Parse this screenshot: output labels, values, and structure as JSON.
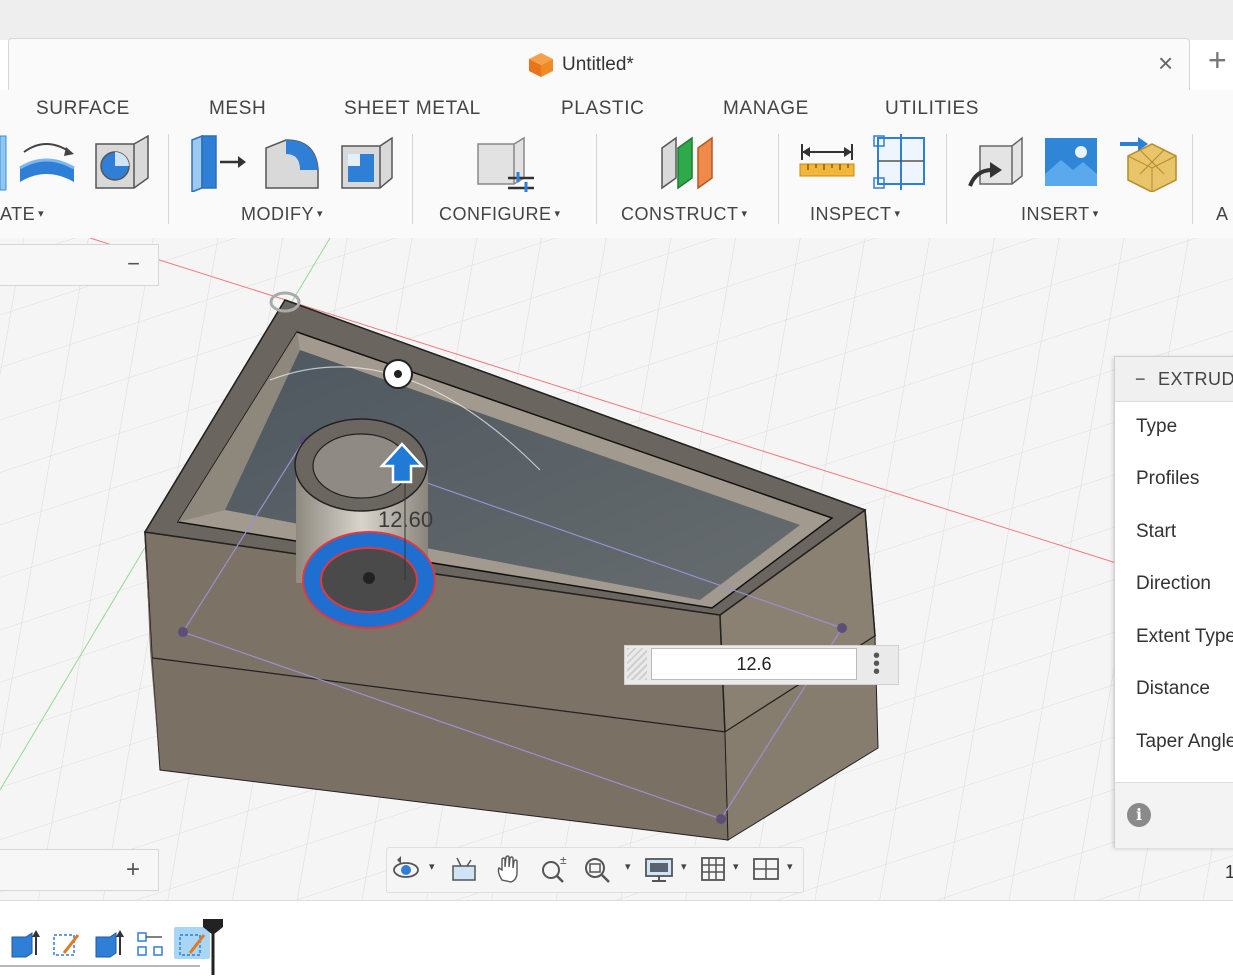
{
  "document": {
    "title": "Untitled*"
  },
  "ribbon": {
    "tabs": [
      "SURFACE",
      "MESH",
      "SHEET METAL",
      "PLASTIC",
      "MANAGE",
      "UTILITIES"
    ],
    "groups": {
      "create": "ATE",
      "modify": "MODIFY",
      "configure": "CONFIGURE",
      "construct": "CONSTRUCT",
      "inspect": "INSPECT",
      "insert": "INSERT",
      "next": "A"
    },
    "caret": "▾"
  },
  "panels": {
    "browser_minimize": "−",
    "comments_add": "+"
  },
  "viewport": {
    "dimension_label": "12.60",
    "dimension_input_value": "12.6"
  },
  "extrude": {
    "header_title": "EXTRUDE",
    "collapse": "−",
    "fields": [
      "Type",
      "Profiles",
      "Start",
      "Direction",
      "Extent Type",
      "Distance",
      "Taper Angle"
    ],
    "info": "i"
  },
  "status": {
    "right_char": "1"
  },
  "colors": {
    "accent_blue": "#1f6fd1",
    "profile_red": "#e0393e",
    "selection_blue": "#a9d6f5",
    "cube_orange": "#f08a24"
  },
  "icons": {
    "title": "cube-icon",
    "tab_close": "close-icon",
    "new_tab": "plus-icon"
  }
}
